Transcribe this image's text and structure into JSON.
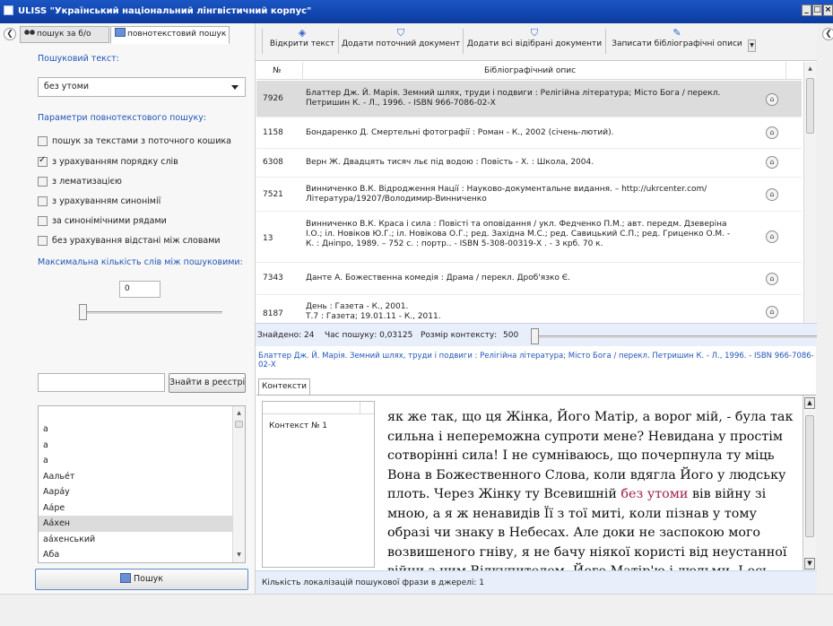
{
  "window": {
    "title": "ULISS \"Український національний лінгвістичний корпус\"",
    "controls": [
      "_",
      "□",
      "×"
    ]
  },
  "left": {
    "tabs": [
      {
        "label": "пошук за б/о",
        "icon": "binoculars-icon"
      },
      {
        "label": "повнотекстовий пошук",
        "icon": "document-icon"
      }
    ],
    "search_text_label": "Пошуковий текст:",
    "search_mode": "без утоми",
    "params_label": "Параметри повнотекстового пошуку:",
    "options": [
      {
        "label": "пошук за текстами з поточного кошика",
        "checked": false
      },
      {
        "label": "з урахуванням порядку слів",
        "checked": true
      },
      {
        "label": "з лематизацією",
        "checked": false
      },
      {
        "label": "з урахуванням синонімії",
        "checked": false
      },
      {
        "label": "за синонімічними рядами",
        "checked": false
      },
      {
        "label": "без урахування відстані між словами",
        "checked": false
      }
    ],
    "max_words_label": "Максимальна кількість слів між пошуковими:",
    "max_words_value": "0",
    "find_in_registry_label": "Знайти в реєстрі",
    "words": [
      "а",
      "а",
      "а",
      "Аальéт",
      "Аарáу",
      "Аáре",
      "Аáхен",
      "аáхенський",
      "Аба"
    ],
    "selected_word_index": 6,
    "search_button_label": "Пошук"
  },
  "toolbar": {
    "buttons": [
      {
        "label": "Відкрити текст",
        "icon": "open-text-icon"
      },
      {
        "label": "Додати поточний документ",
        "icon": "cart-add-icon"
      },
      {
        "label": "Додати всі відібрані документи",
        "icon": "cart-add-all-icon"
      },
      {
        "label": "Записати бібліографічні описи",
        "icon": "write-icon"
      }
    ]
  },
  "table": {
    "col_num": "№",
    "col_desc": "Бібліографічний опис",
    "rows": [
      {
        "num": "7926",
        "desc": "Блаттер Дж. Й. Марія. Земний шлях, труди і подвиги : Релігійна література; Місто Бога / перекл. Петришин К. - Л., 1996. - ISBN 966-7086-02-Х",
        "selected": true
      },
      {
        "num": "1158",
        "desc": "Бондаренко Д. Смертельні фотографії : Роман - К., 2002 (січень-лютий).",
        "selected": false
      },
      {
        "num": "6308",
        "desc": "Верн Ж. Двадцять тисяч льє під водою : Повість - Х. : Школа, 2004.",
        "selected": false
      },
      {
        "num": "7521",
        "desc": "Винниченко В.К. Відродження Нації : Науково-документальне видання. – http://ukrcenter.com/Література/19207/Володимир-Винниченко",
        "selected": false
      },
      {
        "num": "13",
        "desc": "Винниченко В.К. Краса і сила : Повісті та оповідання / укл. Федченко П.М.; авт. передм. Дзеверіна І.О.; іл. Новіков Ю.Г.; іл. Новікова О.Г.; ред. Західна М.С.; ред. Савицький С.П.; ред. Гриценко О.М. - К. : Дніпро, 1989. – 752 с. : портр.. - ISBN 5-308-00319-Х . - 3 крб. 70 к.",
        "selected": false
      },
      {
        "num": "7343",
        "desc": "Данте А. Божественна комедія : Драма / перекл. Дроб'язко Є.",
        "selected": false
      },
      {
        "num": "8187",
        "desc": "День : Газета - К., 2001.\nТ.7 : Газета; 19.01.11 - К., 2011.",
        "selected": false
      }
    ]
  },
  "status": {
    "found": "Знайдено: 24",
    "time": "Час пошуку: 0,03125",
    "context_size_label": "Розмір контексту:",
    "context_size_value": "500"
  },
  "selected_reference": "Блаттер Дж. Й. Марія. Земний шлях, труди і подвиги : Релігійна література; Місто Бога / перекл. Петришин К. - Л., 1996. - ISBN 966-7086-02-Х",
  "contexts": {
    "tab_label": "Контексти",
    "items": [
      "Контекст № 1"
    ],
    "text_before": "як же так, що ця Жінка, Його Матір, а ворог мій, - була так сильна і непереможна супроти мене? Невидана у простім сотворінні сила! І не сумніваюсь, що почерпнула ту міць Вона в Божественного Слова, коли вдягла Його у людську плоть. Через Жінку ту Всевишній ",
    "highlight": "без утоми",
    "text_after": " вів війну зі мною, а я ж ненавидів Її з тої миті, коли пізнав у тому образі чи знаку в Небесах. Але доки не заспокою мого возвишеного гніву, я не бачу ніякої користі від неустанної війни з цим Відкупителем, Його Матір'ю і людьми. І ось",
    "footer": "Кількість локалізацій пошукової фрази в джерелі: 1"
  }
}
